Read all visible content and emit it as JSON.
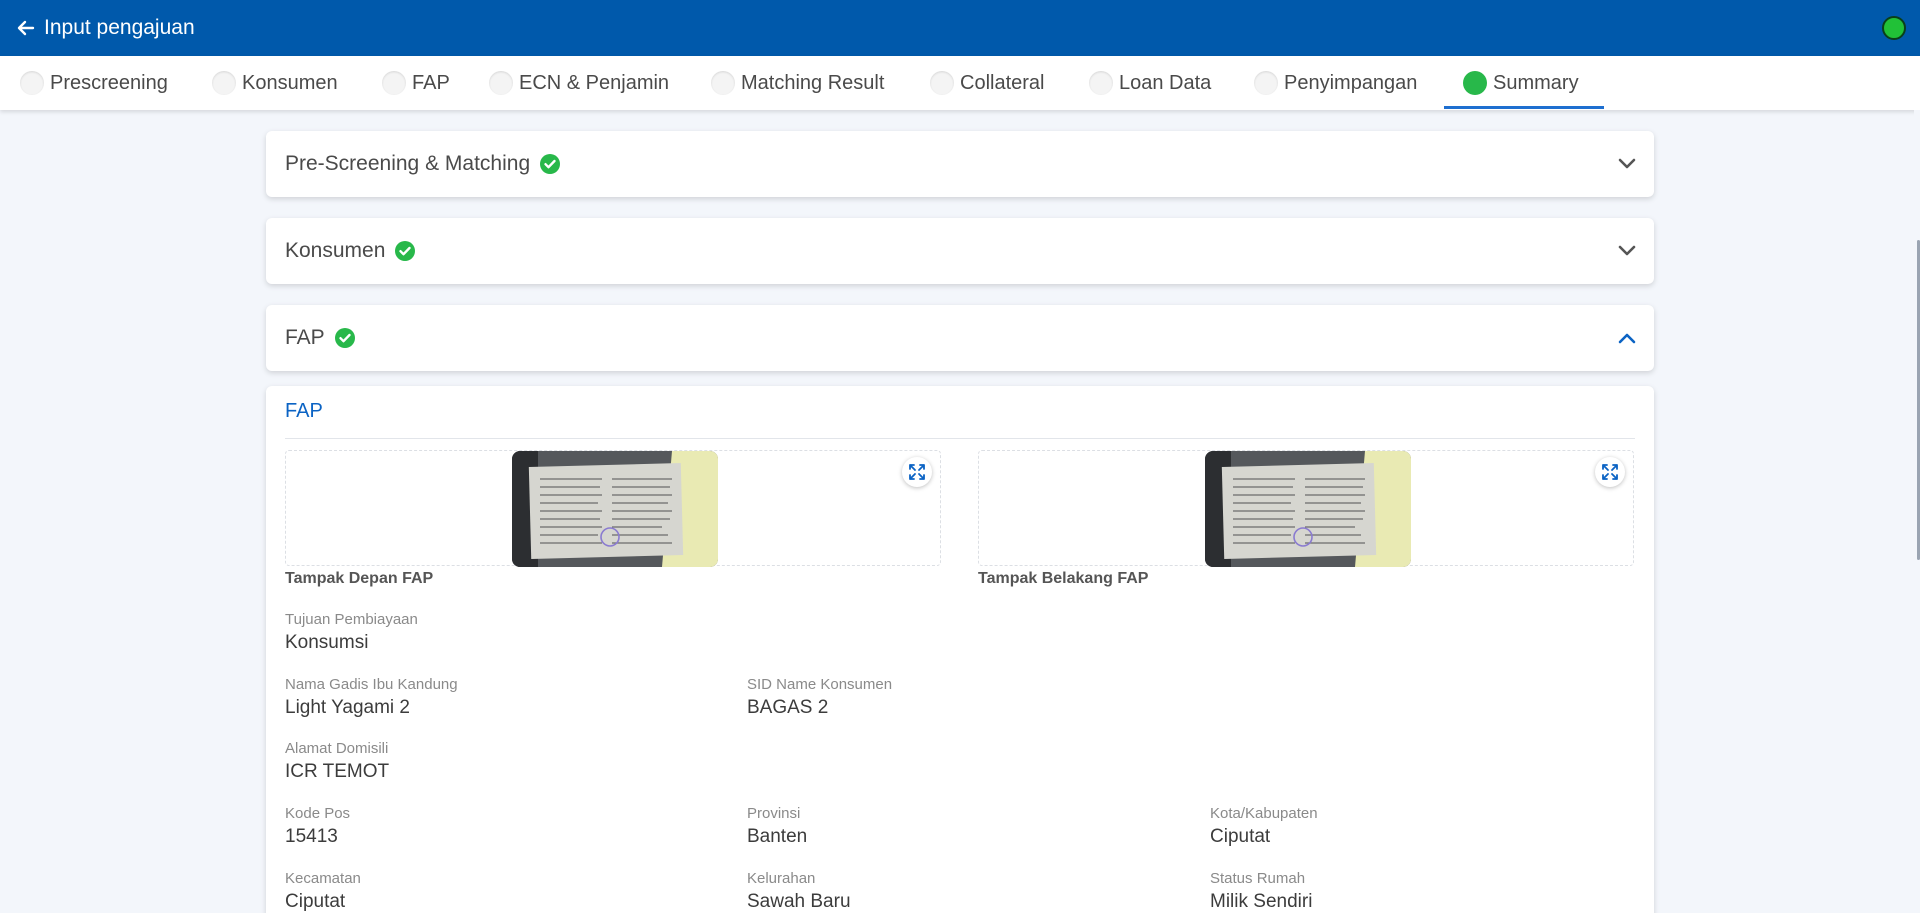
{
  "header": {
    "title": "Input pengajuan",
    "icon": "arrow-left-icon"
  },
  "tabs": [
    {
      "label": "Prescreening",
      "active": false
    },
    {
      "label": "Konsumen",
      "active": false
    },
    {
      "label": "FAP",
      "active": false
    },
    {
      "label": "ECN & Penjamin",
      "active": false
    },
    {
      "label": "Matching Result",
      "active": false
    },
    {
      "label": "Collateral",
      "active": false
    },
    {
      "label": "Loan Data",
      "active": false
    },
    {
      "label": "Penyimpangan",
      "active": false
    },
    {
      "label": "Summary",
      "active": true
    }
  ],
  "accordions": [
    {
      "title": "Pre-Screening & Matching",
      "expanded": false
    },
    {
      "title": "Konsumen",
      "expanded": false
    },
    {
      "title": "FAP",
      "expanded": true
    }
  ],
  "fap": {
    "section_title": "FAP",
    "images": [
      {
        "caption": "Tampak Depan FAP"
      },
      {
        "caption": "Tampak Belakang FAP"
      }
    ],
    "fields": {
      "tujuan_pembiayaan": {
        "label": "Tujuan Pembiayaan",
        "value": "Konsumsi"
      },
      "nama_gadis_ibu": {
        "label": "Nama Gadis Ibu Kandung",
        "value": "Light Yagami 2"
      },
      "sid_name": {
        "label": "SID Name Konsumen",
        "value": "BAGAS 2"
      },
      "alamat_domisili": {
        "label": "Alamat Domisili",
        "value": "ICR TEMOT"
      },
      "kode_pos": {
        "label": "Kode Pos",
        "value": "15413"
      },
      "provinsi": {
        "label": "Provinsi",
        "value": "Banten"
      },
      "kota": {
        "label": "Kota/Kabupaten",
        "value": "Ciputat"
      },
      "kecamatan": {
        "label": "Kecamatan",
        "value": "Ciputat"
      },
      "kelurahan": {
        "label": "Kelurahan",
        "value": "Sawah Baru"
      },
      "status_rumah": {
        "label": "Status Rumah",
        "value": "Milik Sendiri"
      }
    }
  },
  "colors": {
    "primary": "#0059ab",
    "success": "#28b84a",
    "accent": "#0b63c4"
  }
}
